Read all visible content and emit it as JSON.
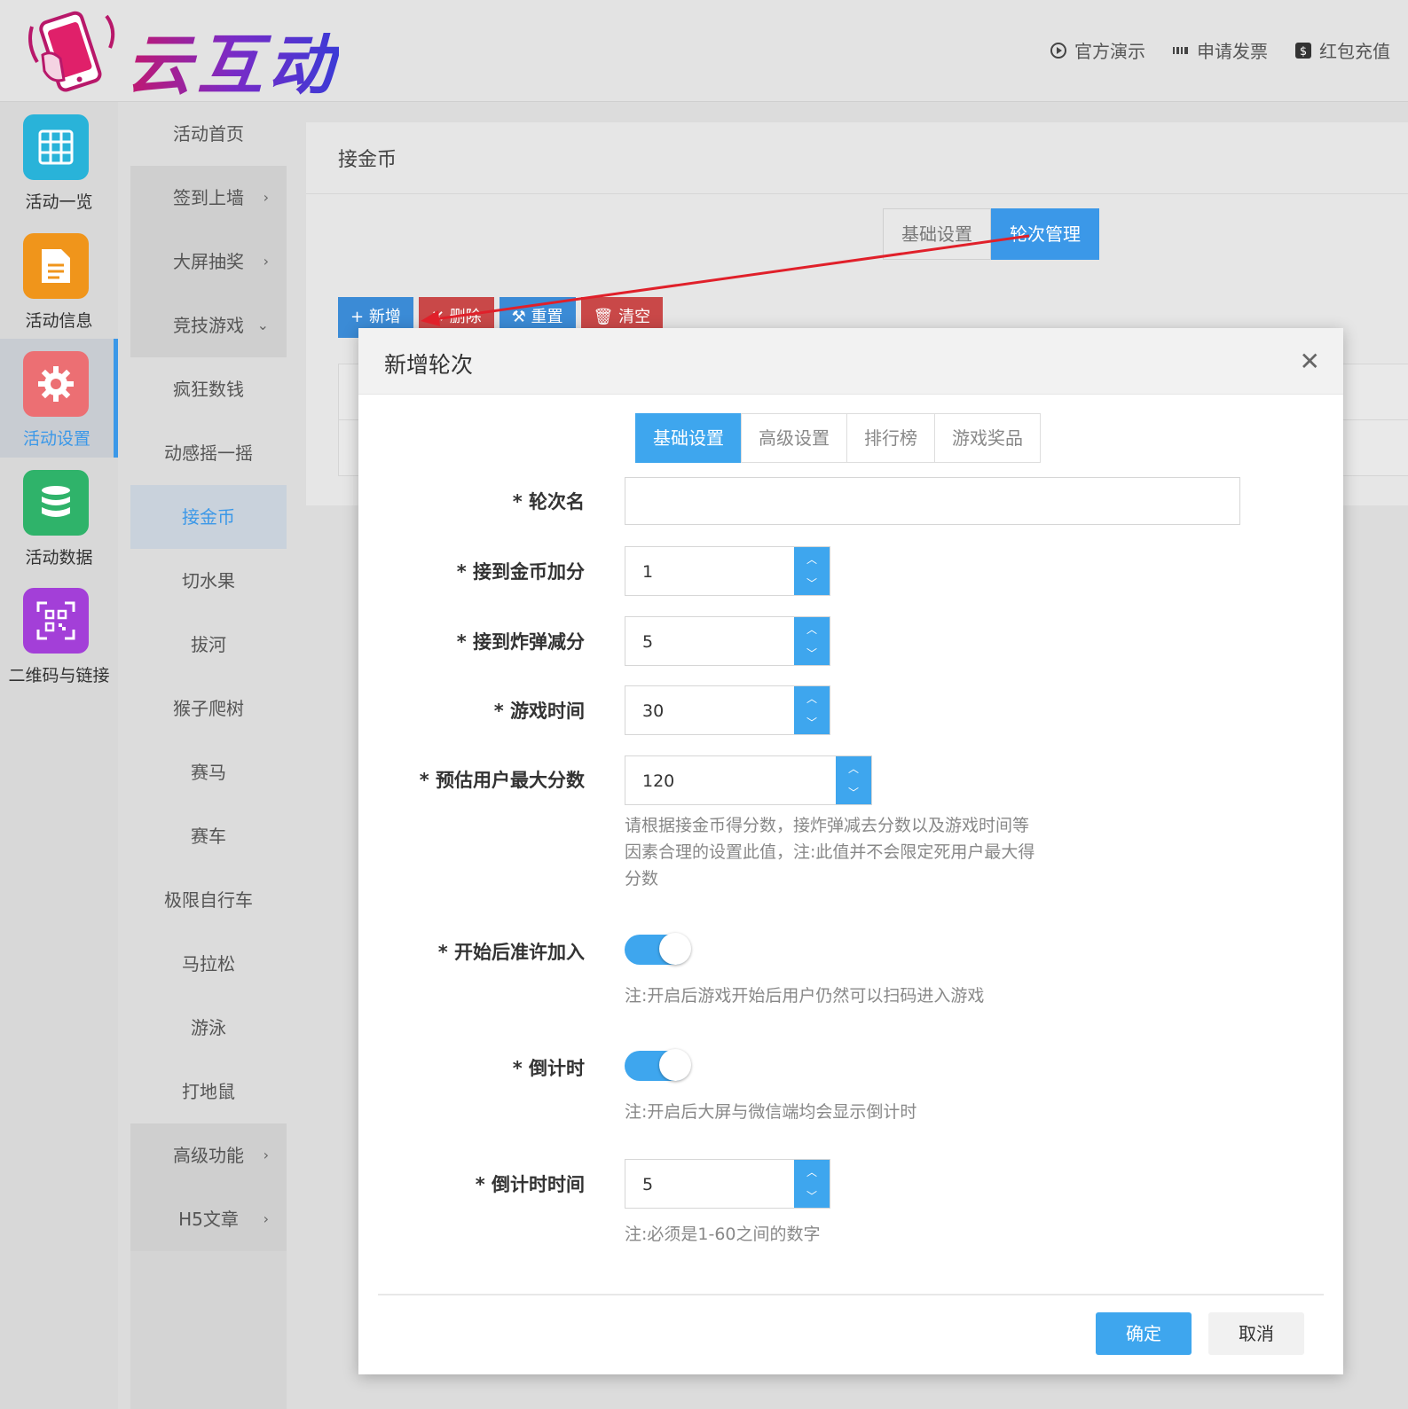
{
  "header": {
    "logo_text": "云互动",
    "links": [
      {
        "icon": "play-circle-icon",
        "label": "官方演示"
      },
      {
        "icon": "barcode-icon",
        "label": "申请发票"
      },
      {
        "icon": "dollar-icon",
        "label": "红包充值"
      }
    ]
  },
  "rail": {
    "items": [
      {
        "label": "活动一览",
        "icon": "grid-icon",
        "color": "#29b3d9"
      },
      {
        "label": "活动信息",
        "icon": "document-icon",
        "color": "#f0951b"
      },
      {
        "label": "活动设置",
        "icon": "gear-icon",
        "color": "#ec6f73"
      },
      {
        "label": "活动数据",
        "icon": "database-icon",
        "color": "#2fb36a"
      },
      {
        "label": "二维码与链接",
        "icon": "qrcode-icon",
        "color": "#a33fd8"
      }
    ]
  },
  "submenu": {
    "items": [
      {
        "label": "活动首页",
        "arrow": ""
      },
      {
        "label": "签到上墙",
        "arrow": "›"
      },
      {
        "label": "大屏抽奖",
        "arrow": "›"
      },
      {
        "label": "竞技游戏",
        "arrow": "⌄"
      },
      {
        "label": "疯狂数钱",
        "arrow": ""
      },
      {
        "label": "动感摇一摇",
        "arrow": ""
      },
      {
        "label": "接金币",
        "arrow": ""
      },
      {
        "label": "切水果",
        "arrow": ""
      },
      {
        "label": "拔河",
        "arrow": ""
      },
      {
        "label": "猴子爬树",
        "arrow": ""
      },
      {
        "label": "赛马",
        "arrow": ""
      },
      {
        "label": "赛车",
        "arrow": ""
      },
      {
        "label": "极限自行车",
        "arrow": ""
      },
      {
        "label": "马拉松",
        "arrow": ""
      },
      {
        "label": "游泳",
        "arrow": ""
      },
      {
        "label": "打地鼠",
        "arrow": ""
      },
      {
        "label": "高级功能",
        "arrow": "›"
      },
      {
        "label": "H5文章",
        "arrow": "›"
      }
    ]
  },
  "panel": {
    "title": "接金币",
    "tabs": [
      "基础设置",
      "轮次管理"
    ],
    "buttons": [
      {
        "icon": "plus-icon",
        "glyph": "+",
        "label": "新增"
      },
      {
        "icon": "close-icon",
        "glyph": "✕",
        "label": "删除"
      },
      {
        "icon": "gavel-icon",
        "glyph": "⚒",
        "label": "重置"
      },
      {
        "icon": "trash-icon",
        "glyph": "🗑",
        "label": "清空"
      }
    ]
  },
  "modal": {
    "title": "新增轮次",
    "close_glyph": "✕",
    "tabs": [
      "基础设置",
      "高级设置",
      "排行榜",
      "游戏奖品"
    ],
    "fields": {
      "round_name": {
        "label": "* 轮次名",
        "value": ""
      },
      "coin_score": {
        "label": "* 接到金币加分",
        "value": "1"
      },
      "bomb_penalty": {
        "label": "* 接到炸弹减分",
        "value": "5"
      },
      "game_time": {
        "label": "* 游戏时间",
        "value": "30"
      },
      "max_score": {
        "label": "* 预估用户最大分数",
        "value": "120",
        "help": [
          "请根据接金币得分数，接炸弹减去分数以及游戏时间等",
          "因素合理的设置此值，注:此值并不会限定死用户最大得",
          "分数"
        ]
      },
      "allow_join": {
        "label": "* 开始后准许加入",
        "on": true,
        "help": "注:开启后游戏开始后用户仍然可以扫码进入游戏"
      },
      "countdown": {
        "label": "* 倒计时",
        "on": true,
        "help": "注:开启后大屏与微信端均会显示倒计时"
      },
      "countdown_time": {
        "label": "* 倒计时时间",
        "value": "5",
        "help": "注:必须是1-60之间的数字"
      }
    },
    "ok_label": "确定",
    "cancel_label": "取消"
  }
}
